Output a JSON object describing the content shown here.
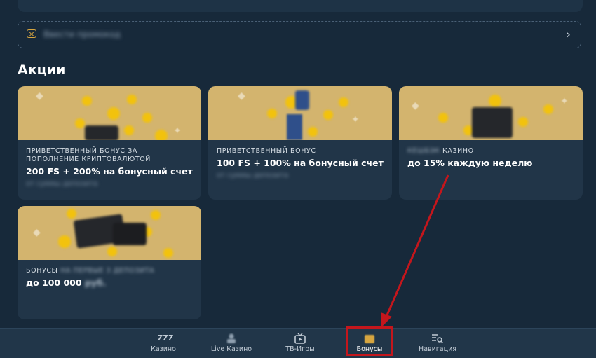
{
  "promo": {
    "placeholder": "Ввести промокод"
  },
  "section": {
    "title": "Акции"
  },
  "cards": [
    {
      "category": "ПРИВЕТСТВЕННЫЙ БОНУС ЗА ПОПОЛНЕНИЕ КРИПТОВАЛЮТОЙ",
      "title": "200 FS + 200% на бонусный счет",
      "subtitle": "от суммы депозита"
    },
    {
      "category": "ПРИВЕТСТВЕННЫЙ БОНУС",
      "title": "100 FS + 100% на бонусный счет",
      "subtitle": "от суммы депозита"
    },
    {
      "category_blurred": "КЕШБЭК",
      "category": "КАЗИНО",
      "title": "до 15% каждую неделю"
    },
    {
      "category": "БОНУСЫ",
      "category_blurred": "на первые 3 депозита",
      "title": "до 100 000",
      "title_blurred": "руб."
    }
  ],
  "nav": {
    "items": [
      {
        "label": "Казино",
        "icon": "777-icon"
      },
      {
        "label": "Live Казино",
        "icon": "live-dealer-icon"
      },
      {
        "label": "ТВ-Игры",
        "icon": "tv-icon"
      },
      {
        "label": "Бонусы",
        "icon": "gift-icon"
      },
      {
        "label": "Навигация",
        "icon": "menu-search-icon"
      }
    ],
    "active": "Бонусы"
  },
  "colors": {
    "background": "#17293a",
    "card": "#213548",
    "accent_gold": "#d7a640",
    "highlight_red": "#c4161c"
  }
}
